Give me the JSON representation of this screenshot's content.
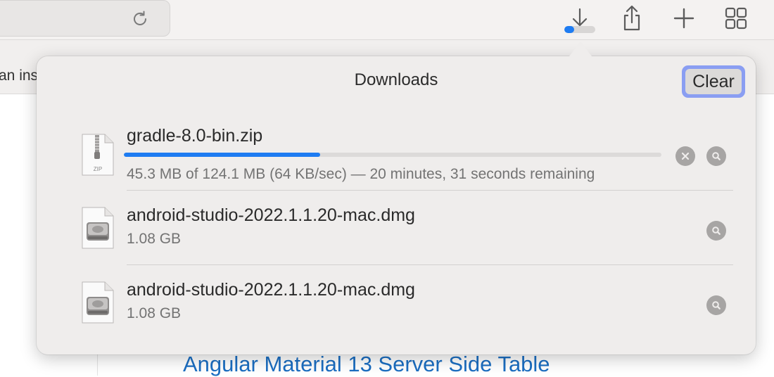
{
  "toolbar": {
    "reload_icon": "reload-icon",
    "download_icon": "download-arrow-icon",
    "download_progress": 0.32,
    "share_icon": "share-icon",
    "new_tab_icon": "plus-icon",
    "tab_overview_icon": "tab-grid-icon"
  },
  "tab": {
    "visible_text": "an ins"
  },
  "page": {
    "link_text": "Angular Material 13 Server Side Table"
  },
  "downloads": {
    "title": "Downloads",
    "clear_label": "Clear",
    "items": [
      {
        "name": "gradle-8.0-bin.zip",
        "status": "45.3 MB of 124.1 MB (64 KB/sec) — 20 minutes, 31 seconds remaining",
        "progress": 0.365,
        "icon": "zip-file-icon",
        "icon_label": "ZIP",
        "in_progress": true
      },
      {
        "name": "android-studio-2022.1.1.20-mac.dmg",
        "status": "1.08 GB",
        "icon": "disk-image-icon",
        "in_progress": false
      },
      {
        "name": "android-studio-2022.1.1.20-mac.dmg",
        "status": "1.08 GB",
        "icon": "disk-image-icon",
        "in_progress": false
      }
    ]
  },
  "colors": {
    "accent": "#1e7cf2",
    "focus_ring": "#8a9ef2",
    "link": "#1b6ec2",
    "popover_bg": "#efedec"
  }
}
